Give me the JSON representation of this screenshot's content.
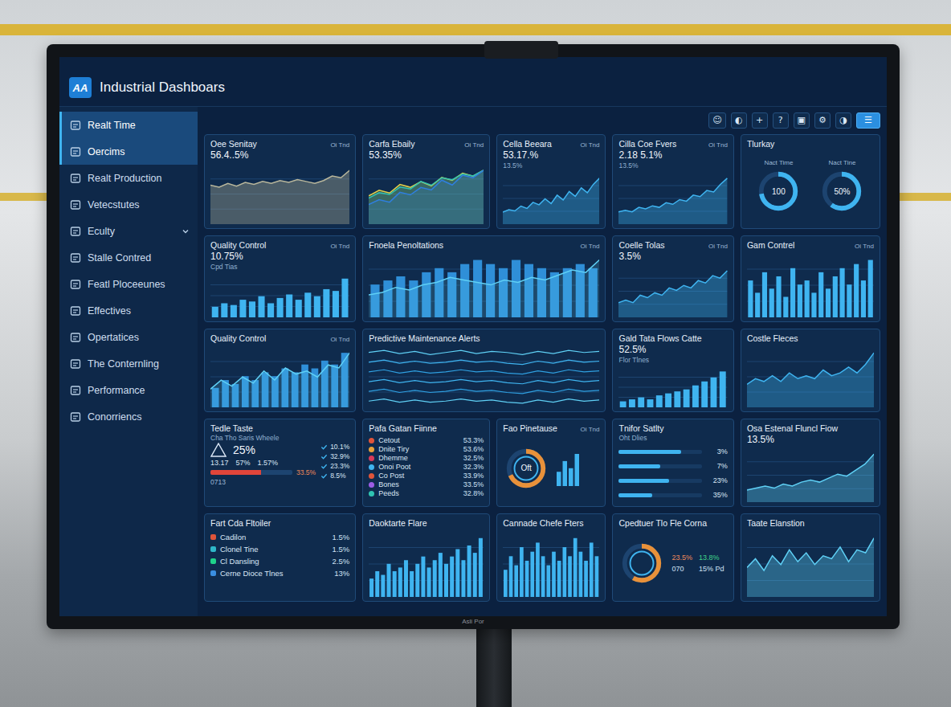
{
  "monitor": {
    "brand": "Asli Por"
  },
  "app": {
    "logo": "AA",
    "title": "Industrial Dashboars"
  },
  "toolbar": [
    {
      "glyph": "☺",
      "selected": false
    },
    {
      "glyph": "◐",
      "selected": false
    },
    {
      "glyph": "+",
      "selected": false
    },
    {
      "glyph": "?",
      "selected": false
    },
    {
      "glyph": "▣",
      "selected": false
    },
    {
      "glyph": "⚙",
      "selected": false
    },
    {
      "glyph": "◑",
      "selected": false
    },
    {
      "glyph": "☰",
      "selected": true
    }
  ],
  "sidebar": [
    {
      "label": "Realt Time",
      "selected": true,
      "expandable": false
    },
    {
      "label": "Oercims",
      "selected": true,
      "expandable": false
    },
    {
      "label": "Realt Production",
      "selected": false,
      "expandable": false
    },
    {
      "label": "Vetecstutes",
      "selected": false,
      "expandable": false
    },
    {
      "label": "Eculty",
      "selected": false,
      "expandable": true
    },
    {
      "label": "Stalle Contred",
      "selected": false,
      "expandable": false
    },
    {
      "label": "Featl Ploceeunes",
      "selected": false,
      "expandable": false
    },
    {
      "label": "Effectives",
      "selected": false,
      "expandable": false
    },
    {
      "label": "Opertatices",
      "selected": false,
      "expandable": false
    },
    {
      "label": "The Conternling",
      "selected": false,
      "expandable": false
    },
    {
      "label": "Performance",
      "selected": false,
      "expandable": false
    },
    {
      "label": "Conorriencs",
      "selected": false,
      "expandable": false
    }
  ],
  "cards": [
    {
      "title": "Oee Senitay",
      "tag": "Oi Tnd",
      "value": "56.4..5%",
      "kind": "area",
      "series": [
        {
          "color": "#b9b79c",
          "values": [
            42,
            40,
            44,
            41,
            45,
            43,
            46,
            44,
            47,
            45,
            48,
            46,
            44,
            47,
            52,
            50,
            58
          ]
        }
      ]
    },
    {
      "title": "Carfa Ebaily",
      "tag": "Oi Tnd",
      "value": "53.35%",
      "kind": "lines",
      "series": [
        {
          "color": "#e3d14a",
          "values": [
            20,
            24,
            22,
            28,
            26,
            30,
            27,
            33,
            31,
            36,
            34,
            38
          ]
        },
        {
          "color": "#2fc4b2",
          "values": [
            14,
            17,
            16,
            20,
            19,
            23,
            21,
            25,
            24,
            27,
            26,
            29
          ]
        },
        {
          "color": "#2f7fe0",
          "values": [
            8,
            10,
            9,
            13,
            12,
            15,
            14,
            18,
            16,
            20,
            19,
            22
          ]
        }
      ]
    },
    {
      "title": "Cella Beeara",
      "tag": "Oi Tnd",
      "value": "53.17.%",
      "sub": "13.5%",
      "kind": "area",
      "series": [
        {
          "color": "#3fb4f0",
          "values": [
            10,
            12,
            11,
            15,
            13,
            18,
            16,
            21,
            17,
            24,
            20,
            27,
            23,
            30,
            26,
            33,
            38
          ]
        }
      ]
    },
    {
      "title": "Cilla Coe Fvers",
      "tag": "Oi Tnd",
      "value": "2.18 5.1%",
      "sub": "13.5%",
      "kind": "area",
      "series": [
        {
          "color": "#3fb4f0",
          "values": [
            8,
            9,
            8,
            11,
            10,
            12,
            11,
            14,
            13,
            16,
            15,
            19,
            18,
            22,
            21,
            26,
            30
          ]
        }
      ]
    },
    {
      "title": "Tlurkay",
      "kind": "donuts",
      "donuts": [
        {
          "label": "Nact Time",
          "value": "100",
          "level": 0.72
        },
        {
          "label": "Nact Tine",
          "value": "50%",
          "level": 0.6
        }
      ]
    },
    {
      "title": "Quality Control",
      "tag": "Oi Tnd",
      "value": "10.75%",
      "sub": "Cpd Tias",
      "kind": "bars",
      "series": [
        {
          "color": "#3fb4f0",
          "values": [
            6,
            8,
            7,
            10,
            9,
            12,
            8,
            11,
            13,
            10,
            14,
            12,
            16,
            15,
            22
          ]
        }
      ]
    },
    {
      "title": "Fnoela Penoltations",
      "tag": "Oi Tnd",
      "kind": "combo",
      "series": [
        {
          "color": "#2f8fd8",
          "values": [
            8,
            9,
            10,
            9,
            11,
            12,
            11,
            13,
            14,
            13,
            12,
            14,
            13,
            12,
            11,
            12,
            13,
            12
          ]
        },
        {
          "color": "#5fd0f5",
          "values": [
            9,
            10,
            12,
            11,
            13,
            14,
            16,
            15,
            14,
            13,
            15,
            14,
            16,
            15,
            17,
            19,
            18,
            23
          ]
        }
      ]
    },
    {
      "title": "Coelle Tolas",
      "tag": "Oi Tnd",
      "value": "3.5%",
      "kind": "area",
      "series": [
        {
          "color": "#3fb4f0",
          "values": [
            6,
            7,
            6,
            9,
            8,
            10,
            9,
            12,
            11,
            13,
            12,
            15,
            14,
            17,
            16,
            19
          ]
        }
      ]
    },
    {
      "title": "Gam Contrel",
      "tag": "Oi Tnd",
      "kind": "bars",
      "series": [
        {
          "color": "#3fb4f0",
          "values": [
            9,
            6,
            11,
            7,
            10,
            5,
            12,
            8,
            9,
            6,
            11,
            7,
            10,
            12,
            8,
            13,
            9,
            14
          ]
        }
      ]
    },
    {
      "title": "Quality Control",
      "tag": "Oi Tnd",
      "kind": "barline",
      "series": [
        {
          "color": "#2f8fd8",
          "values": [
            5,
            7,
            6,
            8,
            7,
            9,
            8,
            10,
            9,
            11,
            10,
            12,
            11,
            14
          ]
        },
        {
          "color": "#5fd0f5",
          "values": [
            6,
            9,
            7,
            10,
            8,
            12,
            9,
            13,
            11,
            12,
            10,
            14,
            13,
            18
          ]
        }
      ]
    },
    {
      "title": "Predictive Maintenance Alerts",
      "kind": "waves",
      "series": [
        {
          "color": "#5fd0f5",
          "values": [
            62,
            64,
            61,
            63,
            60,
            62,
            64,
            61,
            63,
            62,
            60,
            63,
            61,
            64,
            62,
            63
          ]
        },
        {
          "color": "#3fb4f0",
          "values": [
            53,
            55,
            52,
            54,
            52,
            53,
            55,
            53,
            54,
            52,
            51,
            54,
            52,
            55,
            53,
            54
          ]
        },
        {
          "color": "#2f9fe0",
          "values": [
            44,
            46,
            43,
            45,
            43,
            44,
            46,
            44,
            45,
            43,
            42,
            45,
            43,
            46,
            44,
            45
          ]
        },
        {
          "color": "#3fb4f0",
          "values": [
            35,
            37,
            34,
            36,
            34,
            35,
            37,
            35,
            36,
            34,
            33,
            36,
            34,
            37,
            35,
            36
          ]
        },
        {
          "color": "#2f9fe0",
          "values": [
            26,
            28,
            25,
            27,
            25,
            26,
            28,
            26,
            27,
            25,
            24,
            27,
            25,
            28,
            26,
            27
          ]
        },
        {
          "color": "#5fd0f5",
          "values": [
            17,
            19,
            16,
            18,
            16,
            17,
            19,
            17,
            18,
            16,
            15,
            18,
            16,
            19,
            17,
            18
          ]
        }
      ]
    },
    {
      "title": "Gald Tata Flows Catte",
      "value": "52.5%",
      "sub": "Flor Tlnes",
      "kind": "bars",
      "series": [
        {
          "color": "#3fb4f0",
          "values": [
            3,
            4,
            5,
            4,
            6,
            7,
            8,
            9,
            11,
            13,
            15,
            18
          ]
        }
      ]
    },
    {
      "title": "Costle Fleces",
      "kind": "area",
      "series": [
        {
          "color": "#3fb4f0",
          "values": [
            8,
            10,
            9,
            11,
            9,
            12,
            10,
            11,
            10,
            13,
            11,
            12,
            14,
            12,
            15,
            19
          ]
        }
      ]
    },
    {
      "title": "Tedle Taste",
      "sub": "Cha Tho Saris Wheele",
      "kind": "stats",
      "value": "25%",
      "figures": [
        "13.17",
        "57%",
        "1.57%"
      ],
      "readings": [
        "10.1%",
        "32.9%",
        "23.3%",
        "8.5%"
      ],
      "bar": {
        "level": 0.62,
        "reading": "33.5%",
        "label": "0713"
      }
    },
    {
      "title": "Pafa Gatan Fiinne",
      "kind": "list",
      "items": [
        {
          "label": "Cetout",
          "value": "53.3%",
          "color": "#e0553a"
        },
        {
          "label": "Dnite Tiry",
          "value": "53.6%",
          "color": "#e8a23a"
        },
        {
          "label": "Dhemme",
          "value": "32.5%",
          "color": "#d83a5a"
        },
        {
          "label": "Onoi Poot",
          "value": "32.3%",
          "color": "#3fb4f0"
        },
        {
          "label": "Co Post",
          "value": "33.9%",
          "color": "#e0553a"
        },
        {
          "label": "Bones",
          "value": "33.5%",
          "color": "#9b5de5"
        },
        {
          "label": "Peeds",
          "value": "32.8%",
          "color": "#2fc4b2"
        }
      ]
    },
    {
      "title": "Fao Pinetause",
      "tag": "Oi Tnd",
      "kind": "gauge",
      "center": "Oft",
      "level": 0.68,
      "series": [
        {
          "color": "#3fb4f0",
          "values": [
            4,
            7,
            5,
            9
          ]
        }
      ]
    },
    {
      "title": "Tnifor Satlty",
      "sub": "Oht Dlies",
      "kind": "hbars",
      "items": [
        {
          "value": "3%",
          "level": 0.75
        },
        {
          "value": "7%",
          "level": 0.5
        },
        {
          "value": "23%",
          "level": 0.6
        },
        {
          "value": "35%",
          "level": 0.4
        }
      ]
    },
    {
      "title": "Osa Estenal Fluncl Fiow",
      "value": "13.5%",
      "kind": "area",
      "series": [
        {
          "color": "#5fd0f5",
          "values": [
            6,
            7,
            8,
            7,
            9,
            8,
            10,
            11,
            10,
            12,
            14,
            13,
            16,
            19,
            24
          ]
        }
      ]
    },
    {
      "title": "Fart Cda Fltoiler",
      "kind": "legend",
      "items": [
        {
          "label": "Cadilon",
          "value": "1.5%",
          "color": "#e0553a"
        },
        {
          "label": "Clonel Tine",
          "value": "1.5%",
          "color": "#2fb7c9"
        },
        {
          "label": "Cl Dansling",
          "value": "2.5%",
          "color": "#1fd38a"
        },
        {
          "label": "Cerne Dioce Tlnes",
          "value": "13%",
          "color": "#3a8ee0"
        }
      ]
    },
    {
      "title": "Daoktarte Flare",
      "kind": "bars",
      "series": [
        {
          "color": "#3fb4f0",
          "values": [
            5,
            7,
            6,
            9,
            7,
            8,
            10,
            7,
            9,
            11,
            8,
            10,
            12,
            9,
            11,
            13,
            10,
            14,
            12,
            16
          ]
        }
      ]
    },
    {
      "title": "Cannade Chefe Fters",
      "kind": "bars",
      "series": [
        {
          "color": "#3fb4f0",
          "values": [
            6,
            9,
            7,
            11,
            8,
            10,
            12,
            9,
            7,
            10,
            8,
            11,
            9,
            13,
            10,
            8,
            12,
            9
          ]
        }
      ]
    },
    {
      "title": "Cpedtuer Tlo Fle Corna",
      "kind": "gauge",
      "level": 0.58,
      "readings": [
        "23.5%",
        "13.8%",
        "070",
        "15% Pd"
      ]
    },
    {
      "title": "Taate Elanstion",
      "kind": "area",
      "series": [
        {
          "color": "#5fd0f5",
          "values": [
            10,
            13,
            9,
            14,
            11,
            16,
            12,
            15,
            11,
            14,
            13,
            17,
            12,
            16,
            15,
            20
          ]
        }
      ]
    }
  ]
}
